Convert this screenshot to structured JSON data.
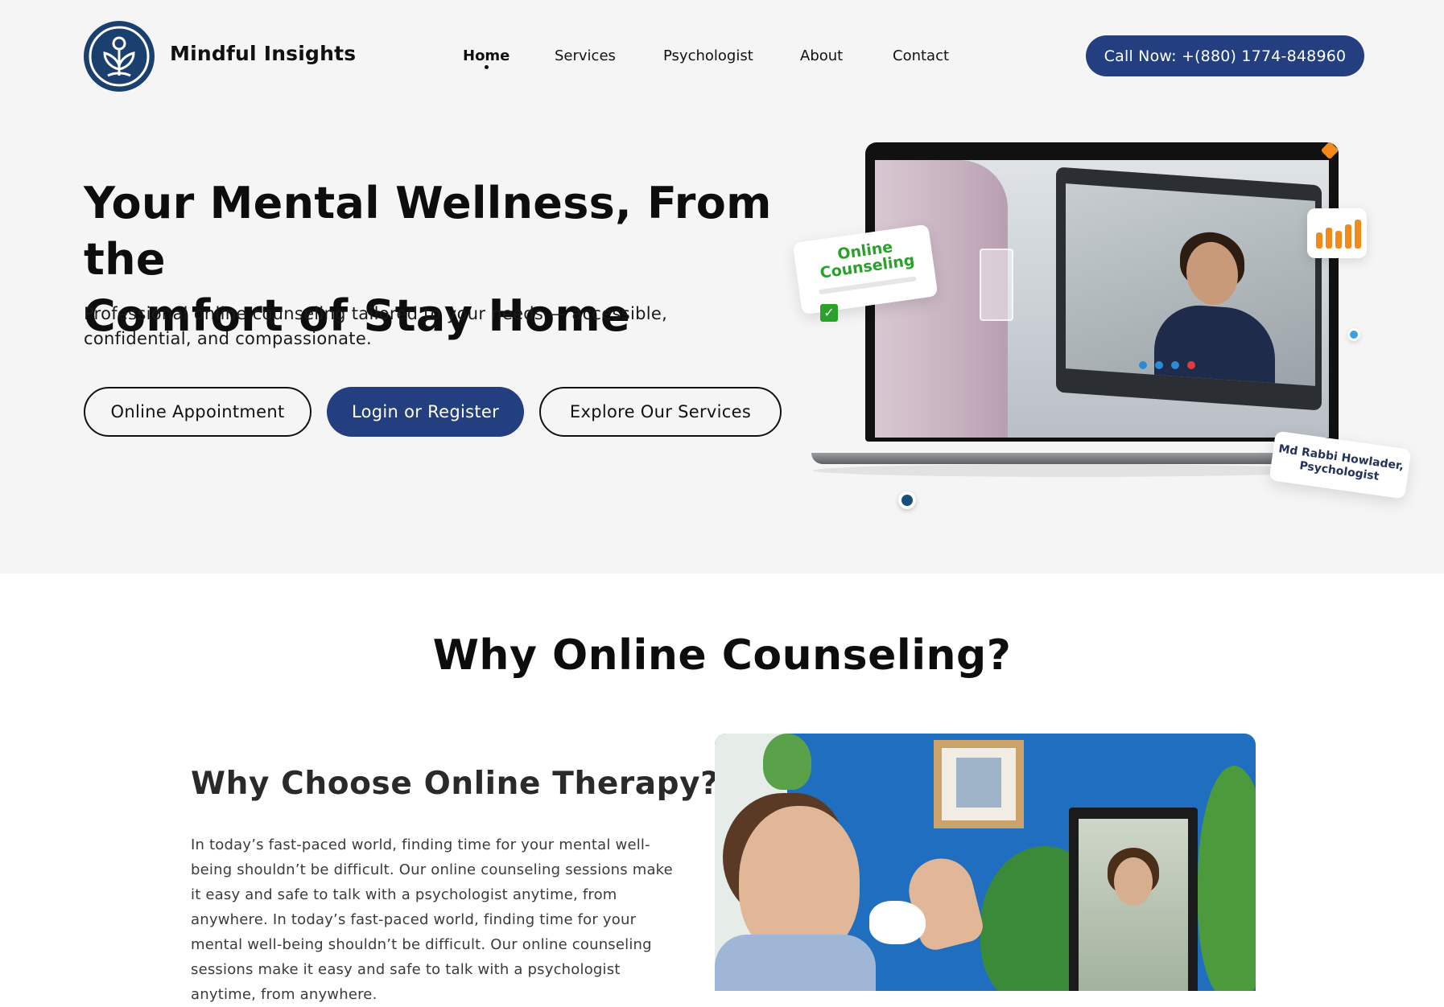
{
  "brand": {
    "name": "Mindful Insights"
  },
  "nav": {
    "items": [
      {
        "label": "Home",
        "active": true
      },
      {
        "label": "Services",
        "active": false
      },
      {
        "label": "Psychologist",
        "active": false
      },
      {
        "label": "About",
        "active": false
      },
      {
        "label": "Contact",
        "active": false
      }
    ]
  },
  "header": {
    "call_label": "Call Now: +(880) 1774-848960"
  },
  "hero": {
    "title_line1": "Your Mental Wellness, From the",
    "title_line2": "Comfort of Stay Home",
    "subtitle_line1": "Professional online counseling tailored to your needs — accessible,",
    "subtitle_line2": "confidential, and compassionate.",
    "buttons": {
      "appointment": "Online Appointment",
      "login": "Login or Register",
      "explore": "Explore Our Services"
    },
    "badge_online": "Online Counseling",
    "psychologist_card": "Md Rabbi Howlader, Psychologist"
  },
  "why": {
    "title": "Why Online Counseling?",
    "subtitle": "Why Choose Online Therapy?",
    "paragraph": "In today’s fast-paced world, finding time for your mental well-being shouldn’t be difficult. Our online counseling sessions make it easy and safe to talk with a psychologist anytime, from anywhere. In today’s fast-paced world, finding time for your mental well-being shouldn’t be difficult. Our online counseling sessions make it easy and safe to talk with a psychologist anytime, from anywhere."
  },
  "colors": {
    "primary": "#233f7f",
    "accent_orange": "#f08a1c",
    "accent_green": "#2aa12a",
    "hero_bg": "#f5f5f5"
  },
  "icons": {
    "logo": "tree-of-life-icon",
    "check": "check-icon",
    "chart": "bar-chart-icon"
  }
}
